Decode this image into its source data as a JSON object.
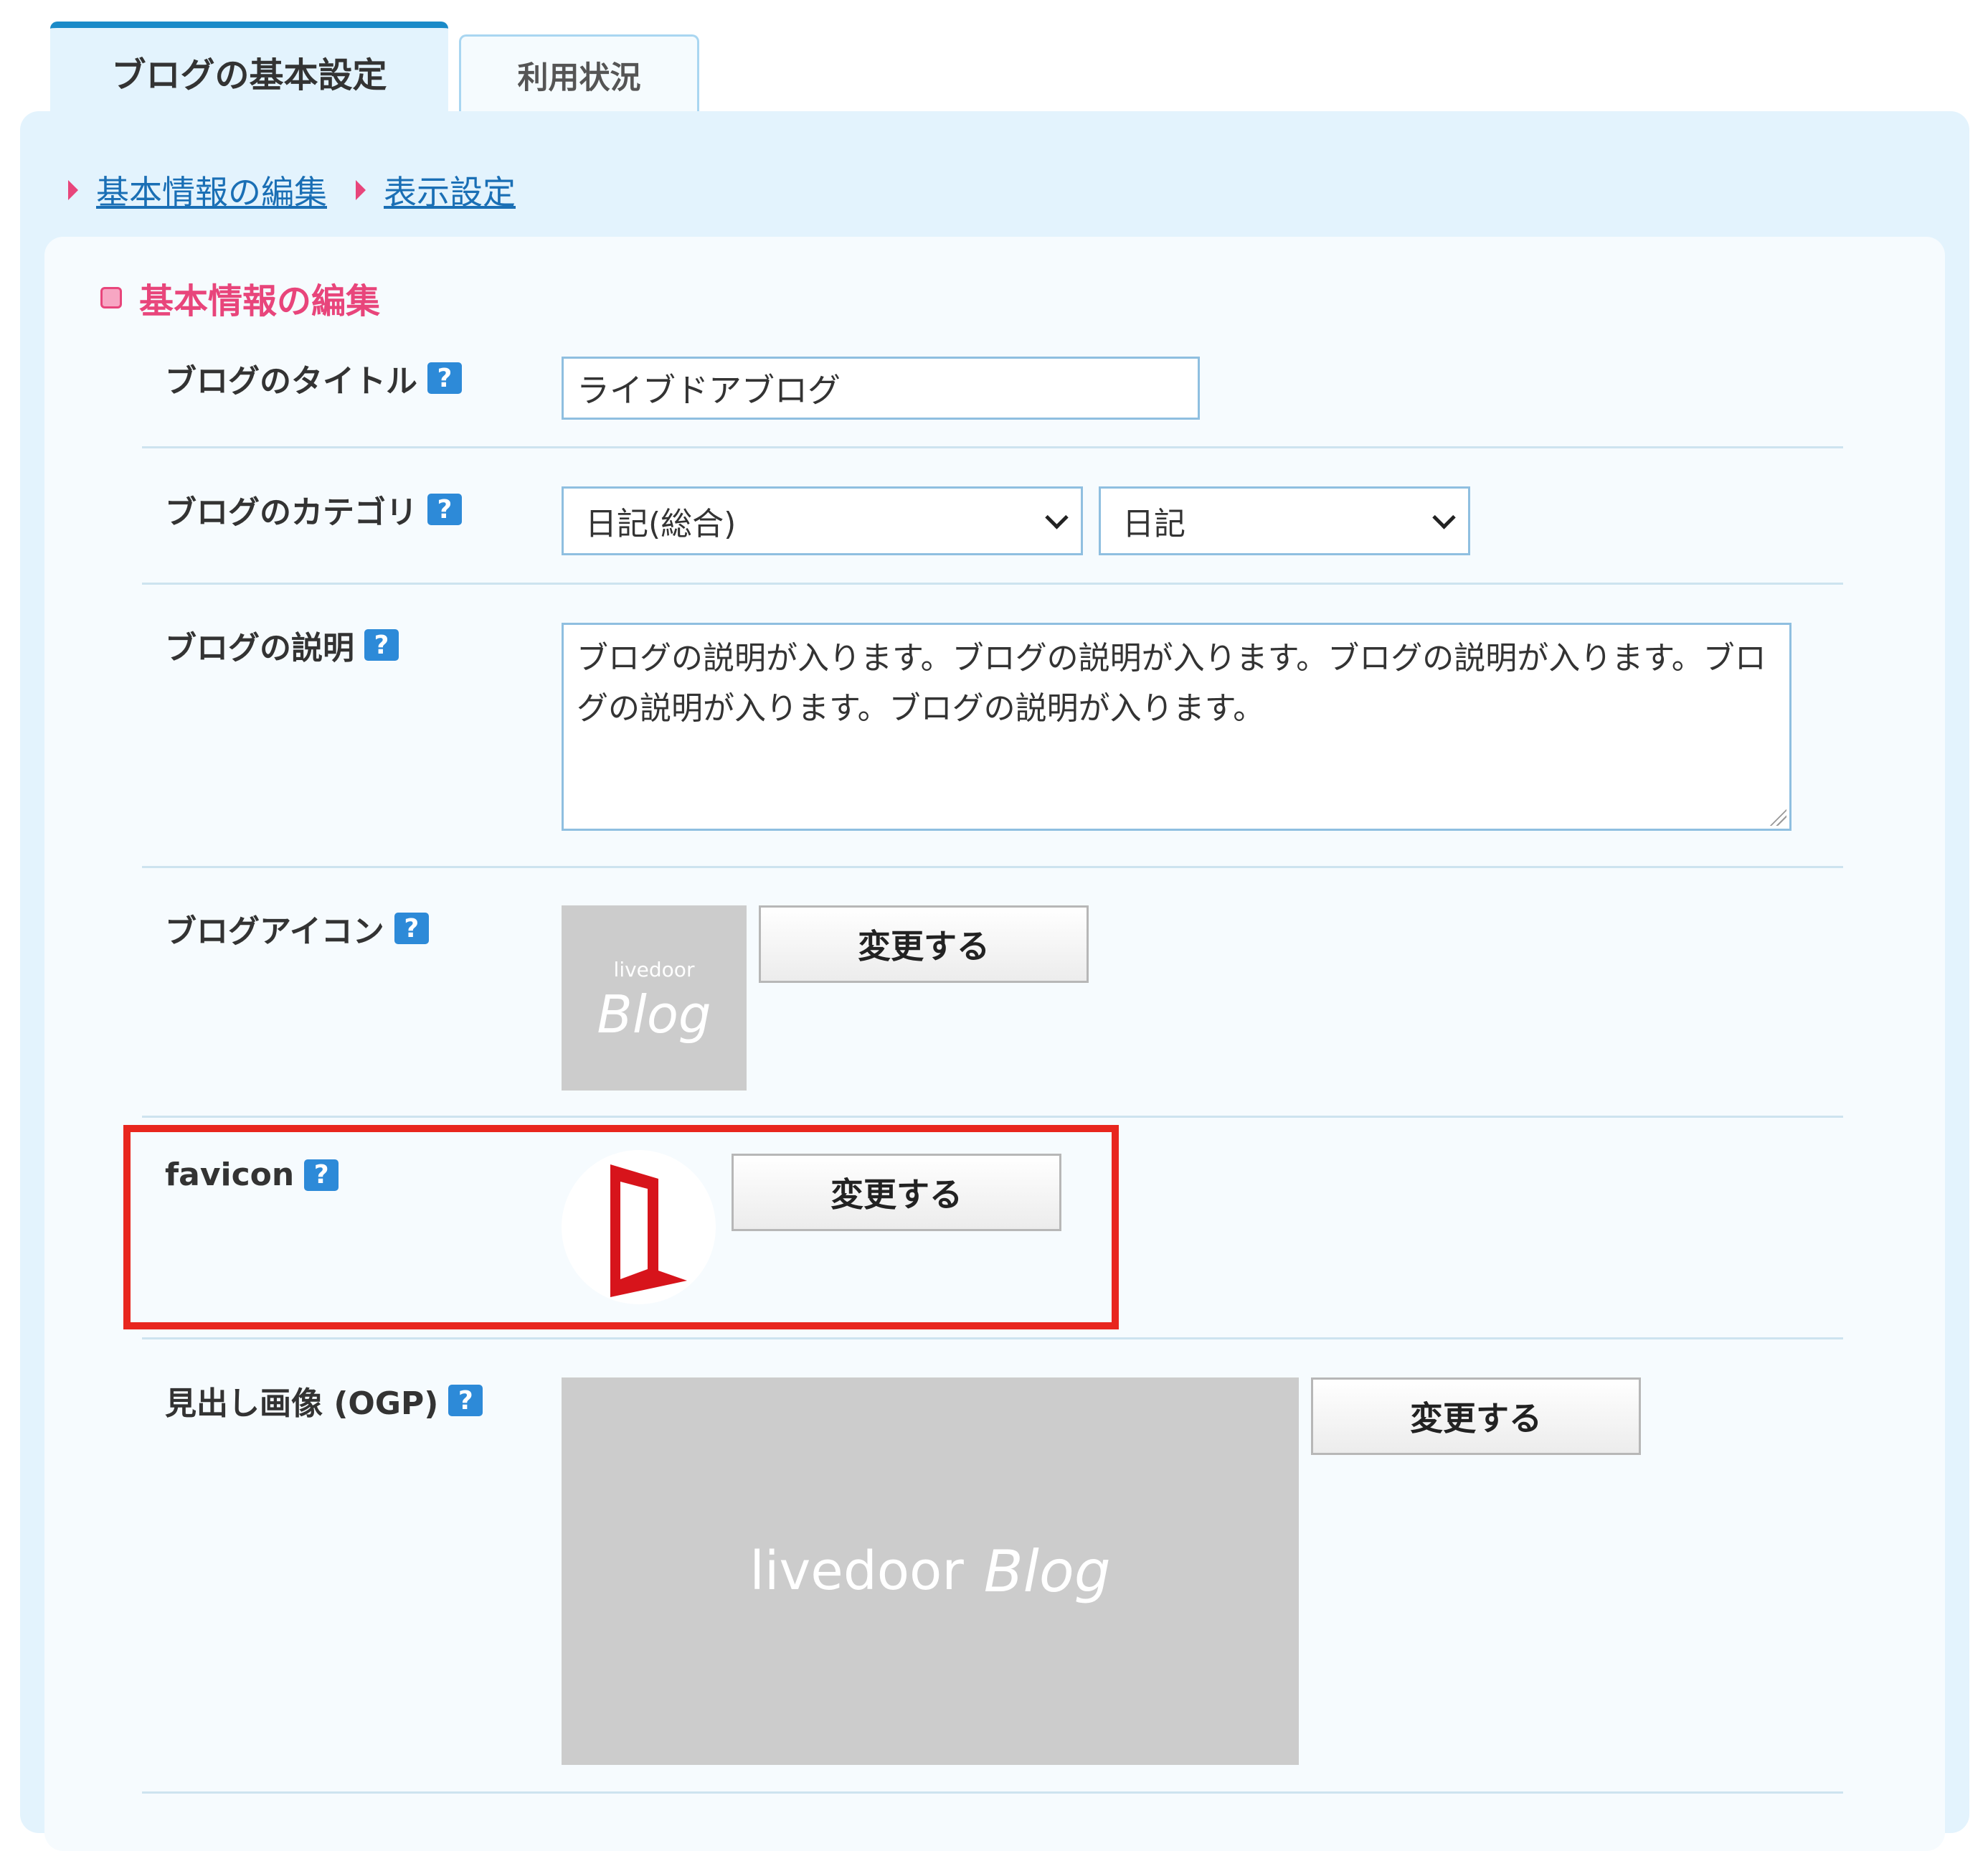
{
  "tabs": [
    {
      "label": "ブログの基本設定",
      "active": true
    },
    {
      "label": "利用状況",
      "active": false
    }
  ],
  "subnav": [
    {
      "label": "基本情報の編集"
    },
    {
      "label": "表示設定"
    }
  ],
  "section": {
    "title": "基本情報の編集"
  },
  "help_glyph": "?",
  "fields": {
    "title": {
      "label": "ブログのタイトル",
      "value": "ライブドアブログ"
    },
    "category": {
      "label": "ブログのカテゴリ",
      "primary": "日記(総合)",
      "secondary": "日記"
    },
    "description": {
      "label": "ブログの説明",
      "value": "ブログの説明が入ります。ブログの説明が入ります。ブログの説明が入ります。ブログの説明が入ります。ブログの説明が入ります。"
    },
    "icon": {
      "label": "ブログアイコン",
      "placeholder_small": "livedoor",
      "placeholder_big": "Blog",
      "button": "変更する"
    },
    "favicon": {
      "label": "favicon",
      "button": "変更する",
      "highlighted": true
    },
    "ogp": {
      "label": "見出し画像 (OGP)",
      "placeholder_word": "livedoor",
      "placeholder_word_italic": "Blog",
      "button": "変更する"
    }
  },
  "colors": {
    "accent_blue": "#1a8ac8",
    "link": "#1a6fb5",
    "section_pink": "#e8457b",
    "highlight_red": "#e8261e",
    "favicon_red": "#d7141b"
  }
}
